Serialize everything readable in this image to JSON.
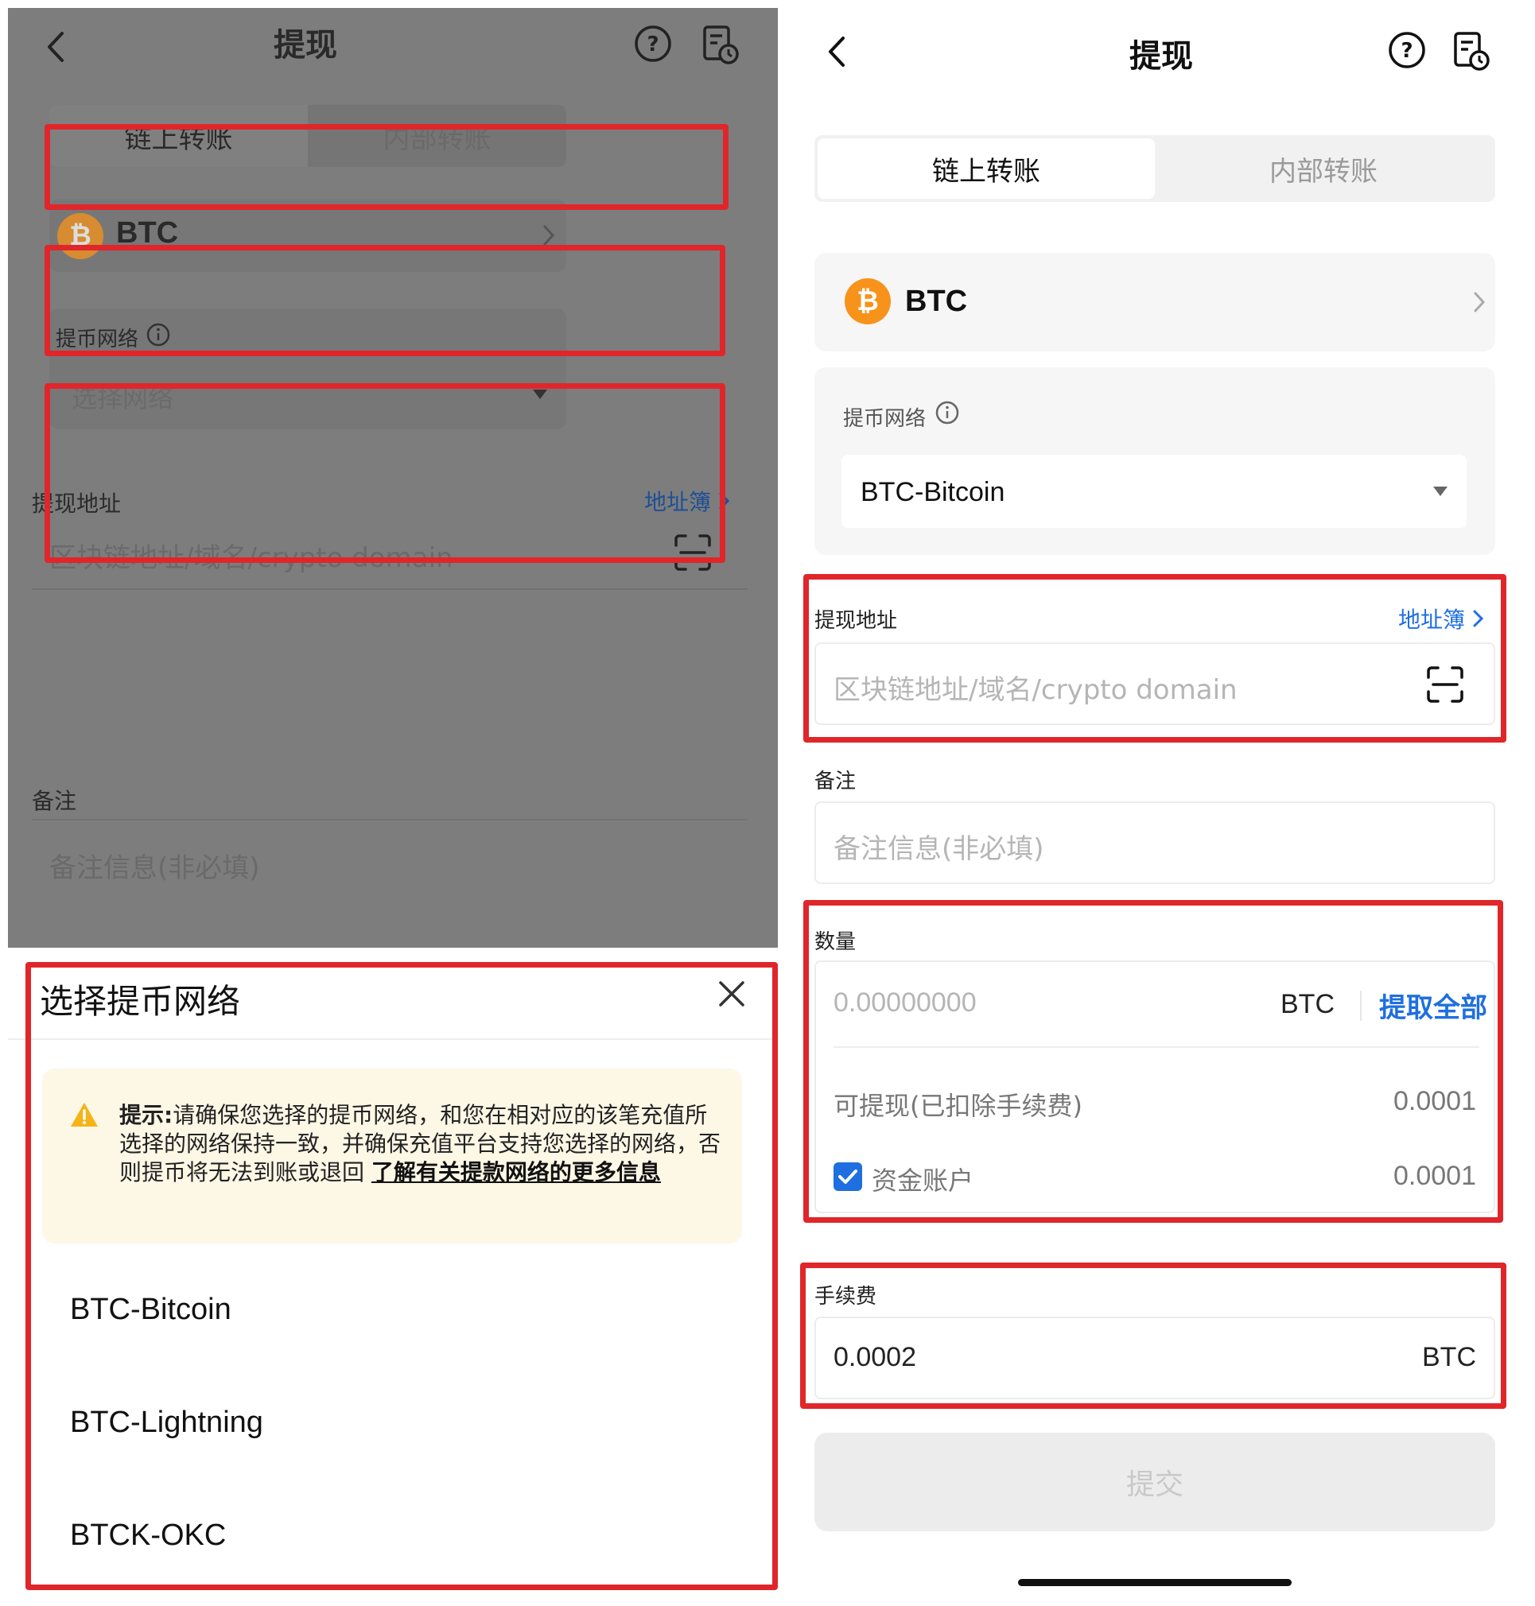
{
  "left": {
    "header": {
      "title": "提现"
    },
    "tabs": [
      {
        "label": "链上转账"
      },
      {
        "label": "内部转账"
      }
    ],
    "coin": {
      "symbol": "BTC"
    },
    "network": {
      "label": "提币网络",
      "placeholder": "选择网络"
    },
    "address": {
      "label": "提现地址",
      "book_link": "地址簿",
      "placeholder": "区块链地址/域名/crypto domain"
    },
    "memo": {
      "label": "备注",
      "placeholder": "备注信息(非必填)"
    },
    "sheet": {
      "title": "选择提币网络",
      "warning_prefix": "提示:",
      "warning_body": "请确保您选择的提币网络，和您在相对应的该笔充值所选择的网络保持一致，并确保充值平台支持您选择的网络，否则提币将无法到账或退回",
      "warning_link": "了解有关提款网络的更多信息",
      "options": [
        "BTC-Bitcoin",
        "BTC-Lightning",
        "BTCK-OKC"
      ]
    }
  },
  "right": {
    "header": {
      "title": "提现"
    },
    "tabs": [
      {
        "label": "链上转账"
      },
      {
        "label": "内部转账"
      }
    ],
    "coin": {
      "symbol": "BTC"
    },
    "network": {
      "label": "提币网络",
      "selected": "BTC-Bitcoin"
    },
    "address": {
      "label": "提现地址",
      "book_link": "地址簿",
      "placeholder": "区块链地址/域名/crypto domain"
    },
    "memo": {
      "label": "备注",
      "placeholder": "备注信息(非必填)"
    },
    "amount": {
      "label": "数量",
      "placeholder": "0.00000000",
      "unit": "BTC",
      "max_button": "提取全部",
      "available_label": "可提现(已扣除手续费)",
      "available_value": "0.0001",
      "funding_label": "资金账户",
      "funding_value": "0.0001"
    },
    "fee": {
      "label": "手续费",
      "value": "0.0002",
      "unit": "BTC"
    },
    "submit": {
      "label": "提交"
    }
  },
  "colors": {
    "highlight": "#e0262a",
    "accent": "#1f6fe0",
    "coin": "#f7931a",
    "dim_overlay": "#7d7d7d"
  }
}
